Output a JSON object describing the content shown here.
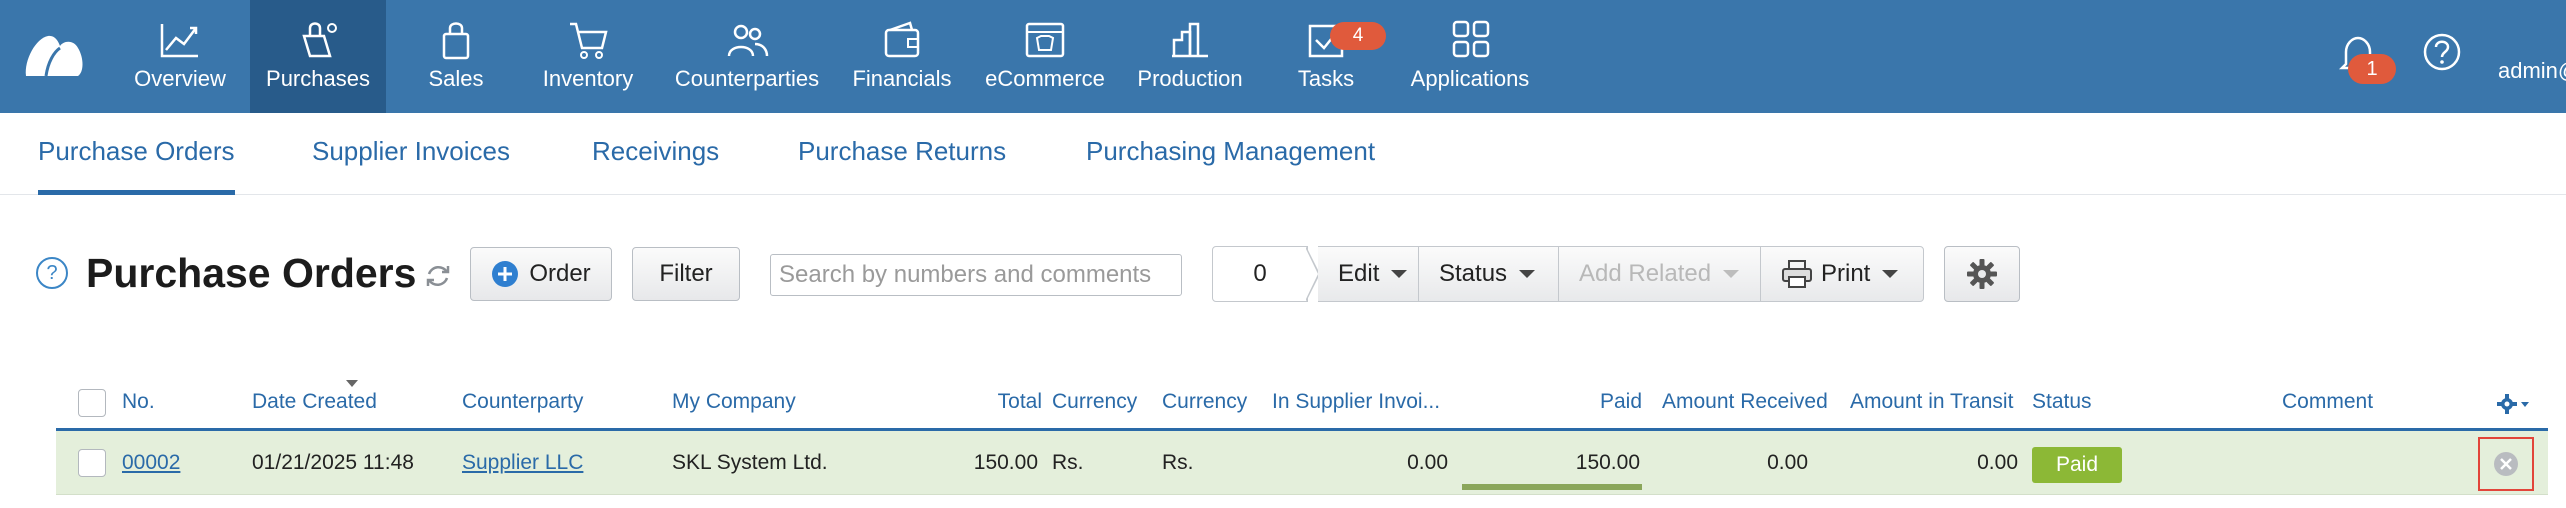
{
  "topnav": {
    "items": [
      {
        "label": "Overview",
        "icon": "chart-line-icon"
      },
      {
        "label": "Purchases",
        "icon": "shopping-bag-icon"
      },
      {
        "label": "Sales",
        "icon": "handbag-icon"
      },
      {
        "label": "Inventory",
        "icon": "cart-icon"
      },
      {
        "label": "Counterparties",
        "icon": "people-icon"
      },
      {
        "label": "Financials",
        "icon": "wallet-icon"
      },
      {
        "label": "eCommerce",
        "icon": "storefront-icon"
      },
      {
        "label": "Production",
        "icon": "factory-icon"
      },
      {
        "label": "Tasks",
        "icon": "checkbox-icon"
      },
      {
        "label": "Applications",
        "icon": "apps-grid-icon"
      }
    ],
    "tasks_badge": "4",
    "notifications_badge": "1",
    "user": "admin@",
    "colors": {
      "bar": "#3a76ab",
      "active": "#285b8a",
      "badge": "#e05a3c"
    }
  },
  "subnav": {
    "tabs": [
      {
        "label": "Purchase Orders"
      },
      {
        "label": "Supplier Invoices"
      },
      {
        "label": "Receivings"
      },
      {
        "label": "Purchase Returns"
      },
      {
        "label": "Purchasing Management"
      }
    ]
  },
  "toolbar": {
    "help": "?",
    "title": "Purchase Orders",
    "order_label": "Order",
    "filter_label": "Filter",
    "search_placeholder": "Search by numbers and comments",
    "selected_count": "0",
    "edit_label": "Edit",
    "status_label": "Status",
    "add_related_label": "Add Related",
    "print_label": "Print"
  },
  "table": {
    "headers": {
      "no": "No.",
      "date_created": "Date Created",
      "counterparty": "Counterparty",
      "my_company": "My Company",
      "total": "Total",
      "currency1": "Currency",
      "currency2": "Currency",
      "in_supplier_invoices": "In Supplier Invoi...",
      "paid": "Paid",
      "amount_received": "Amount Received",
      "amount_in_transit": "Amount in Transit",
      "status": "Status",
      "comment": "Comment"
    },
    "rows": [
      {
        "no": "00002",
        "date_created": "01/21/2025 11:48",
        "counterparty": "Supplier LLC",
        "my_company": "SKL System Ltd.",
        "total": "150.00",
        "currency1": "Rs.",
        "currency2": "Rs.",
        "in_supplier_invoices": "0.00",
        "paid": "150.00",
        "amount_received": "0.00",
        "amount_in_transit": "0.00",
        "status": "Paid",
        "status_color": "#8cb836",
        "comment": ""
      }
    ]
  }
}
